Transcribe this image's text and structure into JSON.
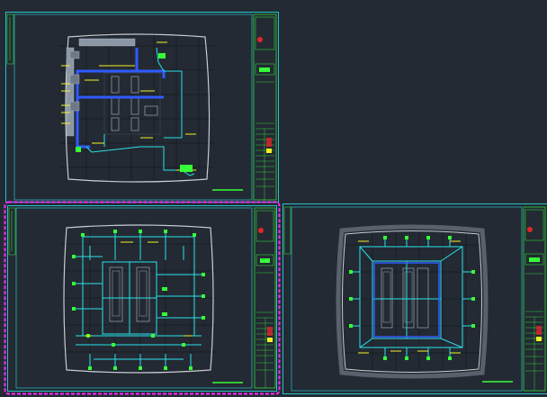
{
  "canvas": {
    "background": "#232a33"
  },
  "colors": {
    "sheet_border": "#27c1c9",
    "title_block": "#2fd43a",
    "plan_outline": "#c8ccd2",
    "grid": "#1b1f25",
    "duct_blue": "#2f5bff",
    "pipe_cyan": "#28e2ea",
    "device_green": "#37ff37",
    "label_yellow": "#f2f227",
    "equipment_gray": "#8c97a6",
    "selection_magenta": "#ff29ff",
    "stamp_red": "#e0262a"
  },
  "drawing_sheets": [
    {
      "id": "sheet-top-left",
      "layout": "l-shaped-ductwork",
      "selected": false
    },
    {
      "id": "sheet-bottom-left",
      "layout": "dense-piping",
      "selected": true
    },
    {
      "id": "sheet-bottom-right",
      "layout": "ring-piping",
      "selected": false
    }
  ]
}
